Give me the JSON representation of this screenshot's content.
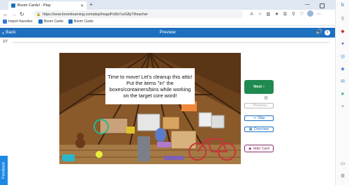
{
  "browser": {
    "tab_title": "Boom Cards! - Play",
    "tab_close": "✕",
    "new_tab": "+",
    "url": "https://wow.boomlearning.com/play/hwgoPu5b7uxG8yTi/teacher",
    "window_controls": {
      "minimize": "—",
      "close": "✕"
    }
  },
  "bookmarks": [
    {
      "label": "Import favorites",
      "icon": "import-icon",
      "color": "#3b78d8"
    },
    {
      "label": "Boom Cards",
      "icon": "boom-icon",
      "color": "#1e6fbe"
    },
    {
      "label": "Boom Cards",
      "icon": "boom-icon",
      "color": "#1e6fbe"
    }
  ],
  "header": {
    "back_icon": "‹",
    "back_label": "Back",
    "title": "Preview",
    "color": "#1e6fbe"
  },
  "progress": {
    "label": "1/7",
    "fraction": 0
  },
  "card": {
    "caption": "Time to move! Let's cleanup this attic! Put the items \"in\" the boxes/containers/bins while working on the target core word!"
  },
  "controls": {
    "next_label": "Next",
    "previous_label": "Previous",
    "skip_label": "Skip",
    "overview_label": "Overview",
    "hide_card_label": "Hide Card"
  },
  "feedback_label": "Feedback",
  "colors": {
    "accent": "#1e6fbe",
    "next_green": "#1f8a4f",
    "hide_card": "#8a2a64",
    "feedback": "#1e88e5"
  }
}
